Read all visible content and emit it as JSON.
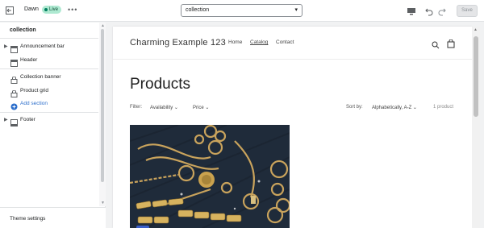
{
  "topbar": {
    "theme_name": "Dawn",
    "live_label": "Live",
    "more_label": "•••",
    "page_select_value": "collection",
    "save_label": "Save"
  },
  "sidebar": {
    "title": "collection",
    "items": [
      {
        "label": "Announcement bar",
        "icon": "section-icon",
        "expandable": true
      },
      {
        "label": "Header",
        "icon": "section-icon",
        "expandable": false
      },
      {
        "label": "Collection banner",
        "icon": "lock-section-icon",
        "expandable": false
      },
      {
        "label": "Product grid",
        "icon": "lock-section-icon",
        "expandable": false
      },
      {
        "label": "Add section",
        "icon": "plus-circle-icon",
        "expandable": false
      },
      {
        "label": "Footer",
        "icon": "section-icon",
        "expandable": true
      }
    ],
    "theme_settings_label": "Theme settings"
  },
  "preview": {
    "store_name": "Charming Example 123",
    "nav": [
      {
        "label": "Home",
        "active": false
      },
      {
        "label": "Catalog",
        "active": true
      },
      {
        "label": "Contact",
        "active": false
      }
    ],
    "page_title": "Products",
    "filter_label": "Filter:",
    "filters": [
      "Availability",
      "Price"
    ],
    "sort_label": "Sort by:",
    "sort_value": "Alphabetically, A-Z",
    "product_count": "1 product"
  },
  "colors": {
    "accent": "#2c6ecb",
    "live_badge": "#aee9d1",
    "product_image_bg": "#1d2836"
  }
}
